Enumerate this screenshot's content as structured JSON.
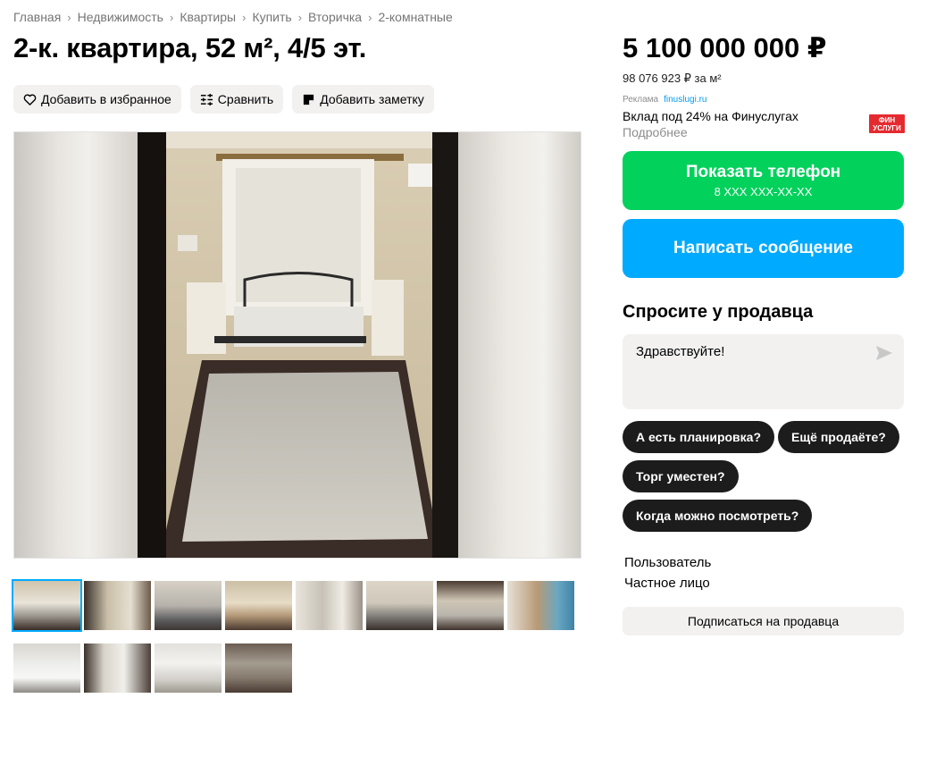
{
  "breadcrumbs": [
    "Главная",
    "Недвижимость",
    "Квартиры",
    "Купить",
    "Вторичка",
    "2-комнатные"
  ],
  "title": "2-к. квартира, 52 м², 4/5 эт.",
  "actions": {
    "favorite_label": "Добавить в избранное",
    "compare_label": "Сравнить",
    "note_label": "Добавить заметку"
  },
  "price": {
    "value": "5 100 000 000 ₽",
    "per_sqm": "98 076 923 ₽ за м²"
  },
  "ad": {
    "label": "Реклама",
    "domain": "finuslugi.ru",
    "title": "Вклад под 24% на Финуслугах",
    "more": "Подробнее",
    "logo_line1": "ФИН",
    "logo_line2": "УСЛУГИ"
  },
  "contact": {
    "phone_label": "Показать телефон",
    "phone_mask": "8 XXX XXX-XX-XX",
    "message_label": "Написать сообщение"
  },
  "ask": {
    "title": "Спросите у продавца",
    "input_value": "Здравствуйте!",
    "chips": [
      "А есть планировка?",
      "Ещё продаёте?",
      "Торг уместен?",
      "Когда можно посмотреть?"
    ]
  },
  "seller": {
    "name": "Пользователь",
    "type": "Частное лицо",
    "subscribe_label": "Подписаться на продавца"
  },
  "gallery": {
    "active_index": 0,
    "thumb_count": 12
  },
  "colors": {
    "phone_button": "#02d15c",
    "message_button": "#00aaff",
    "chip_bg": "#1c1c1c",
    "soft_bg": "#f2f1f0"
  }
}
